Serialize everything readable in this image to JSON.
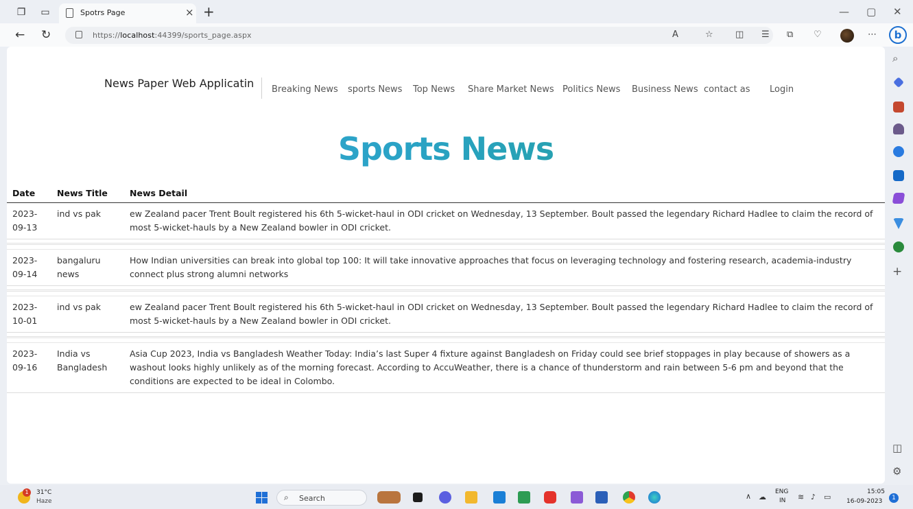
{
  "browser": {
    "tab_title": "Spotrs Page",
    "tab_close": "×",
    "new_tab": "+",
    "url_prefix": "https://",
    "url_host": "localhost",
    "url_rest": ":44399/sports_page.aspx",
    "window_min": "—",
    "window_restore": "▢",
    "window_close": "✕",
    "bing_label": "b"
  },
  "site": {
    "brand": "News Paper Web Applicatin",
    "nav": [
      {
        "label": "Breaking News"
      },
      {
        "label": "sports News"
      },
      {
        "label": "Top News"
      },
      {
        "label": "Share Market News"
      },
      {
        "label": "Politics News"
      },
      {
        "label": "Business News"
      },
      {
        "label": "contact as"
      },
      {
        "label": "Login"
      }
    ],
    "heading": "Sports News"
  },
  "table": {
    "headers": [
      "Date",
      "News Title",
      "News Detail"
    ],
    "rows": [
      {
        "date": "2023-\n09-13",
        "title": "ind vs pak",
        "detail": "ew Zealand pacer Trent Boult registered his 6th 5-wicket-haul in ODI cricket on Wednesday, 13 September. Boult passed the legendary Richard Hadlee to claim the record of most 5-wicket-hauls by a New Zealand bowler in ODI cricket."
      },
      {
        "date": "2023-\n09-14",
        "title": "bangaluru news",
        "detail": "How Indian universities can break into global top 100: It will take innovative approaches that focus on leveraging technology and fostering research, academia-industry connect plus strong alumni networks"
      },
      {
        "date": "2023-\n10-01",
        "title": "ind vs pak",
        "detail": "ew Zealand pacer Trent Boult registered his 6th 5-wicket-haul in ODI cricket on Wednesday, 13 September. Boult passed the legendary Richard Hadlee to claim the record of most 5-wicket-hauls by a New Zealand bowler in ODI cricket."
      },
      {
        "date": "2023-\n09-16",
        "title": "India vs Bangladesh",
        "detail": "Asia Cup 2023, India vs Bangladesh Weather Today: India’s last Super 4 fixture against Bangladesh on Friday could see brief stoppages in play because of showers as a washout looks highly unlikely as of the morning forecast. According to AccuWeather, there is a chance of thunderstorm and rain between 5-6 pm and beyond that the conditions are expected to be ideal in Colombo."
      }
    ]
  },
  "taskbar": {
    "weather_badge": "1",
    "temperature": "31°C",
    "condition": "Haze",
    "search_label": "Search",
    "lang_line1": "ENG",
    "lang_line2": "IN",
    "time": "15:05",
    "date": "16-09-2023",
    "notification_count": "1"
  },
  "colors": {
    "heading_start": "#3aa6d6",
    "heading_end": "#1f9d86",
    "accent": "#1f6fd6"
  }
}
